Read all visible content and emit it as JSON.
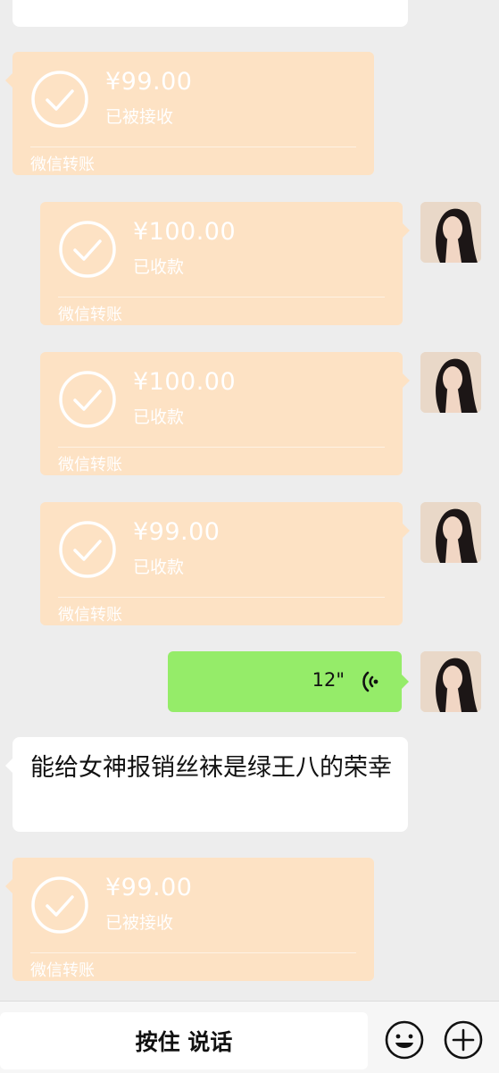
{
  "messages": [
    {
      "side": "left",
      "amount": "¥99.00",
      "status": "已被接收",
      "footer": "微信转账"
    },
    {
      "side": "right",
      "amount": "¥100.00",
      "status": "已收款",
      "footer": "微信转账"
    },
    {
      "side": "right",
      "amount": "¥100.00",
      "status": "已收款",
      "footer": "微信转账"
    },
    {
      "side": "right",
      "amount": "¥99.00",
      "status": "已收款",
      "footer": "微信转账"
    },
    {
      "side": "right",
      "type": "voice",
      "duration": "12\""
    },
    {
      "side": "left",
      "type": "text",
      "text": "能给女神报销丝袜是绿王八的荣幸"
    },
    {
      "side": "left",
      "amount": "¥99.00",
      "status": "已被接收",
      "footer": "微信转账"
    }
  ],
  "input_bar": {
    "hold_to_talk_label": "按住 说话",
    "emoji_icon": "emoji-icon",
    "plus_icon": "plus-icon"
  },
  "colors": {
    "background": "#ededed",
    "transfer_bubble": "#fde2c4",
    "voice_bubble": "#95ec69",
    "text_bubble": "#ffffff"
  }
}
